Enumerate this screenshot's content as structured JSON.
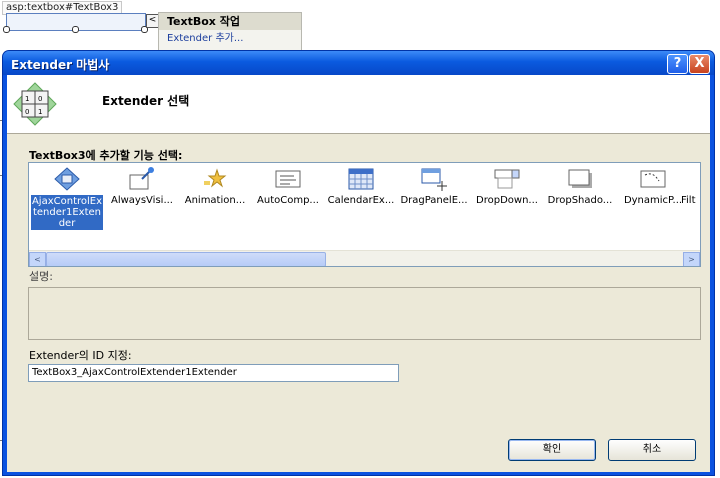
{
  "designer": {
    "element_tag": "asp:textbox#TextBox3",
    "smart_tag_glyph": "<",
    "tasks_panel": {
      "header": "TextBox 작업",
      "item": "Extender 추가..."
    }
  },
  "dialog": {
    "title": "Extender 마법사",
    "help_glyph": "?",
    "close_glyph": "X",
    "header_title": "Extender 선택",
    "list_label": "TextBox3에 추가할 기능 선택:",
    "extenders": [
      {
        "label": "AjaxControlExtender1Extender",
        "icon": "ajax-control-icon",
        "selected": true
      },
      {
        "label": "AlwaysVisi...",
        "icon": "pin-icon",
        "selected": false
      },
      {
        "label": "Animation...",
        "icon": "stars-icon",
        "selected": false
      },
      {
        "label": "AutoComp...",
        "icon": "list-box-icon",
        "selected": false
      },
      {
        "label": "CalendarEx...",
        "icon": "calendar-icon",
        "selected": false
      },
      {
        "label": "DragPanelE...",
        "icon": "drag-panel-icon",
        "selected": false
      },
      {
        "label": "DropDown...",
        "icon": "dropdown-icon",
        "selected": false
      },
      {
        "label": "DropShado...",
        "icon": "drop-shadow-icon",
        "selected": false
      },
      {
        "label": "DynamicP...",
        "icon": "dynamic-populate-icon",
        "selected": false
      },
      {
        "label": "Filt",
        "icon": "filter-icon",
        "selected": false
      }
    ],
    "scroll_left": "<",
    "scroll_right": ">",
    "description_label": "설명:",
    "id_label": "Extender의 ID 지정:",
    "id_value": "TextBox3_AjaxControlExtender1Extender",
    "ok_label": "확인",
    "cancel_label": "취소"
  },
  "colors": {
    "title_bar": "#0a5adf",
    "selection": "#316ac5",
    "dialog_face": "#ece9d8"
  }
}
